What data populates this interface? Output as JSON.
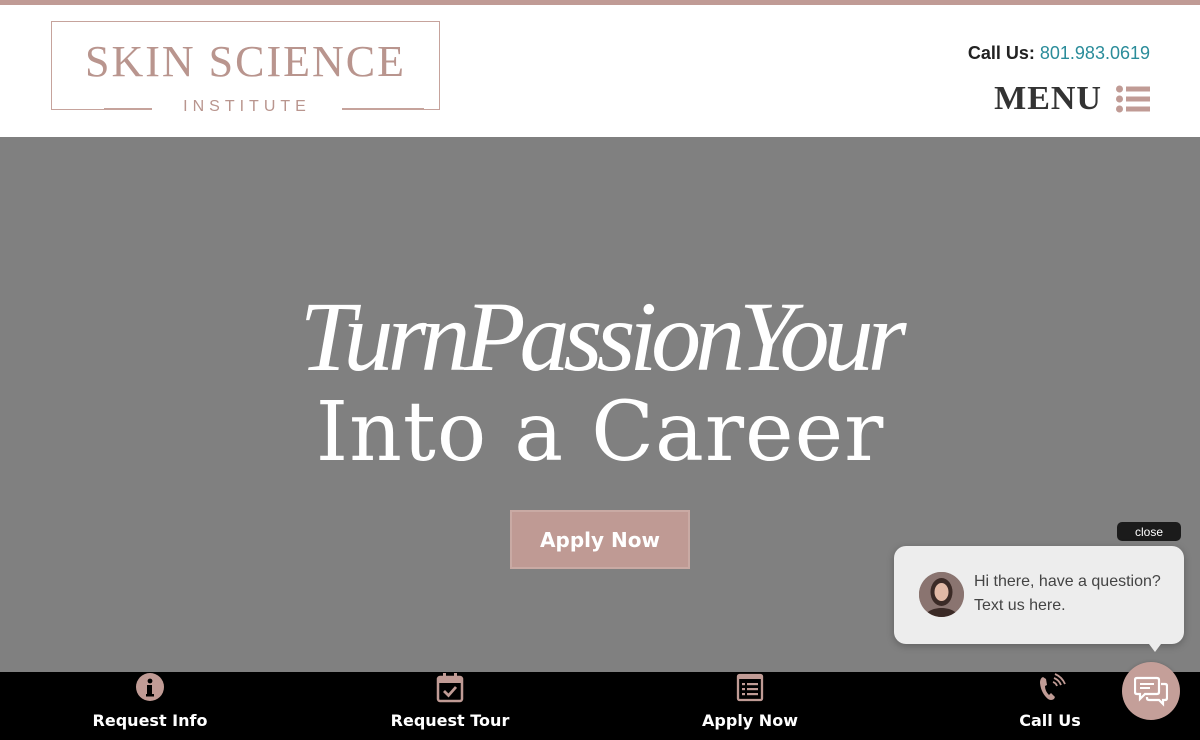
{
  "brand": {
    "logo_main": "SKIN SCIENCE",
    "logo_sub": "INSTITUTE"
  },
  "header": {
    "call_label": "Call Us:",
    "phone": "801.983.0619",
    "menu_label": "MENU"
  },
  "hero": {
    "script_text": "TurnPassionYour",
    "title": "Into a Career",
    "cta_label": "Apply Now"
  },
  "chat": {
    "close_label": "close",
    "message": "Hi there, have a question? Text us here."
  },
  "bottom_bar": {
    "items": [
      {
        "label": "Request Info",
        "icon": "info-icon"
      },
      {
        "label": "Request Tour",
        "icon": "calendar-check-icon"
      },
      {
        "label": "Apply Now",
        "icon": "application-form-icon"
      },
      {
        "label": "Call Us",
        "icon": "phone-icon"
      }
    ]
  },
  "colors": {
    "accent": "#c09b95",
    "hero_bg": "#808080",
    "link": "#2a8c9a",
    "bottom_bar_bg": "#000000"
  }
}
